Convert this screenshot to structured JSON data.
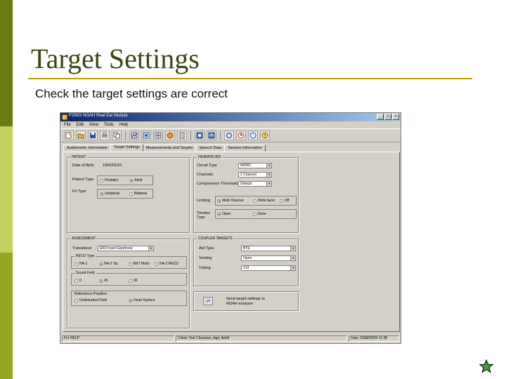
{
  "slide": {
    "title": "Target Settings",
    "subtitle": "Check the target settings are correct"
  },
  "window": {
    "title": "FONIX NOAH Real Ear Module",
    "controls": {
      "minimize": "_",
      "maximize": "□",
      "close": "×"
    }
  },
  "menu": [
    "File",
    "Edit",
    "View",
    "Tools",
    "Help"
  ],
  "tabs": [
    {
      "label": "Audiometric Information",
      "active": false
    },
    {
      "label": "Target Settings",
      "active": true
    },
    {
      "label": "Measurements and Targets",
      "active": false
    },
    {
      "label": "Speech Data",
      "active": false
    },
    {
      "label": "Session Information",
      "active": false
    }
  ],
  "patient": {
    "group_label": "PATIENT",
    "dob_label": "Date of Birth",
    "dob_value": "1950/01/01",
    "patient_type_label": "Patient Type",
    "patient_type_options": [
      "Pediatric",
      "Adult"
    ],
    "fit_type_label": "Fit Type",
    "fit_type_options": [
      "Unilateral",
      "Bilateral"
    ]
  },
  "hearing_aid": {
    "group_label": "HEARING AID",
    "circuit_type_label": "Circuit Type",
    "circuit_type_value": "WDRC",
    "channels_label": "Channels",
    "channels_value": "2 Channel",
    "compression_label": "Compression Threshold",
    "compression_value": "Default",
    "limiting_label": "Limiting",
    "limiting_options": [
      "Multi Channel",
      "Wide band",
      "Off"
    ],
    "tinnitus_label": "Tinnitus Type",
    "tinnitus_options": [
      "Open",
      "None"
    ]
  },
  "assessment": {
    "group_label": "ASSESSMENT",
    "transducer_label": "Transducer",
    "transducer_value": "ER3 Insert Earphone",
    "recd_label": "RECD Type",
    "recd_options": [
      "HA-1",
      "HA-2 Tip",
      "BKT Mold",
      "HA-2 RECD"
    ],
    "sound_field_label": "Sound Field",
    "sound_field_options": [
      "0",
      "45",
      "90"
    ],
    "ref_position_label": "Reference Position",
    "ref_position_options": [
      "Undisturbed Field",
      "Head Surface"
    ]
  },
  "coupler": {
    "group_label": "COUPLER TARGETS",
    "aid_type_label": "Aid Type",
    "aid_type_value": "BTE",
    "venting_label": "Venting",
    "venting_value": "Open",
    "tubing_label": "Tubing",
    "tubing_value": "#13",
    "send_text_line1": "Send target settings to",
    "send_text_line2": "NOAH analyzer"
  },
  "status": {
    "left": "For HELP",
    "middle": "Client: Test Character, Age: Adult",
    "right": "Date: 2008/03/04  11:38"
  },
  "colors": {
    "bar_dark": "#6b7a10",
    "bar_light": "#c3cf5e",
    "title_color": "#3d4710",
    "rule_color": "#b3a000",
    "window_face": "#d4d0c8",
    "titlebar_start": "#0a246a"
  }
}
